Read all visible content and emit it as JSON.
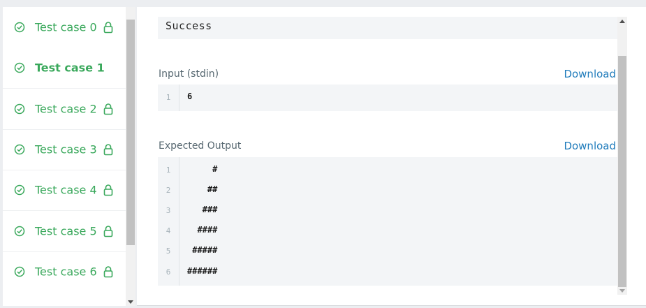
{
  "colors": {
    "success": "#39a85b",
    "link": "#1f7bbb",
    "codeBg": "#f3f5f7"
  },
  "test_cases": [
    {
      "label": "Test case 0",
      "locked": true,
      "active": false
    },
    {
      "label": "Test case 1",
      "locked": false,
      "active": true
    },
    {
      "label": "Test case 2",
      "locked": true,
      "active": false
    },
    {
      "label": "Test case 3",
      "locked": true,
      "active": false
    },
    {
      "label": "Test case 4",
      "locked": true,
      "active": false
    },
    {
      "label": "Test case 5",
      "locked": true,
      "active": false
    },
    {
      "label": "Test case 6",
      "locked": true,
      "active": false
    }
  ],
  "result": {
    "status": "Success"
  },
  "input": {
    "label": "Input (stdin)",
    "download_label": "Download",
    "lines": [
      {
        "n": "1",
        "text": "6"
      }
    ]
  },
  "expected": {
    "label": "Expected Output",
    "download_label": "Download",
    "lines": [
      {
        "n": "1",
        "text": "     #"
      },
      {
        "n": "2",
        "text": "    ##"
      },
      {
        "n": "3",
        "text": "   ###"
      },
      {
        "n": "4",
        "text": "  ####"
      },
      {
        "n": "5",
        "text": " #####"
      },
      {
        "n": "6",
        "text": "######"
      }
    ]
  }
}
